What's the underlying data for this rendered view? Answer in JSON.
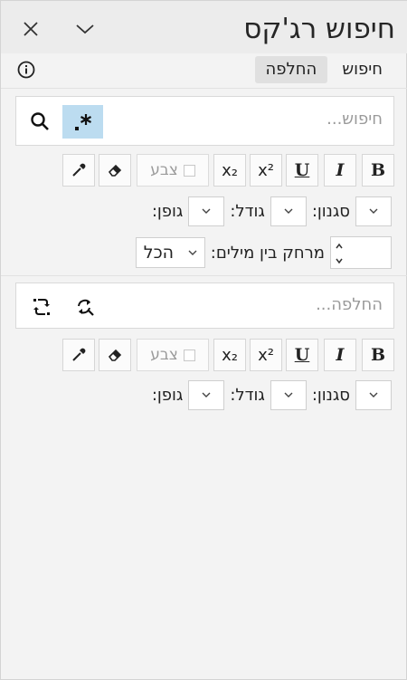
{
  "window": {
    "title": "חיפוש רג'קס"
  },
  "tabs": [
    {
      "label": "חיפוש",
      "active": false
    },
    {
      "label": "החלפה",
      "active": true
    }
  ],
  "search": {
    "placeholder": "חיפוש..."
  },
  "replace": {
    "placeholder": "החלפה..."
  },
  "format": {
    "bold": "B",
    "italic": "I",
    "underline": "U",
    "superscript": "x²",
    "subscript": "x₂",
    "color_label": "צבע"
  },
  "font_row": {
    "font_label": "גופן:",
    "size_label": "גודל:",
    "style_label": "סגנון:"
  },
  "spacing_row": {
    "scope_value": "הכל",
    "label": "מרחק בין מילים:"
  },
  "colors": {
    "accent_toggle_bg": "#bcdcf0"
  }
}
